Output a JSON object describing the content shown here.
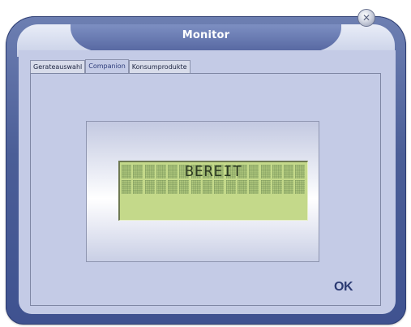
{
  "window": {
    "title": "Monitor"
  },
  "tabs": [
    {
      "label": "Gerateauswahl",
      "active": false
    },
    {
      "label": "Companion",
      "active": true
    },
    {
      "label": "Konsumprodukte",
      "active": false
    }
  ],
  "lcd": {
    "text": "BEREIT",
    "color": "#c4d98a"
  },
  "buttons": {
    "ok_label": "OK",
    "close_glyph": "✕"
  },
  "icons": {
    "close": "close-icon"
  },
  "colors": {
    "window_frame": "#4b5e97",
    "content_bg": "#c4cbe6",
    "ok_text": "#2c3b73"
  }
}
